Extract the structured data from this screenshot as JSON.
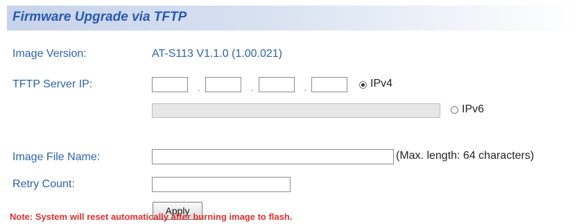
{
  "header": {
    "title": "Firmware Upgrade via TFTP"
  },
  "image_version": {
    "label": "Image Version:",
    "value": "AT-S113 V1.1.0 (1.00.021)"
  },
  "tftp_server": {
    "label": "TFTP Server IP:",
    "octets": [
      "",
      "",
      "",
      ""
    ],
    "separator": ".",
    "ipv4_label": "IPv4",
    "ipv4_selected": true,
    "ipv6_value": "",
    "ipv6_label": "IPv6",
    "ipv6_selected": false
  },
  "image_file": {
    "label": "Image File Name:",
    "value": "",
    "hint": "(Max. length: 64 characters)"
  },
  "retry_count": {
    "label": "Retry Count:",
    "value": ""
  },
  "apply_button": {
    "label": "Apply"
  },
  "note": "Note: System will reset automatically after burning image to flash."
}
